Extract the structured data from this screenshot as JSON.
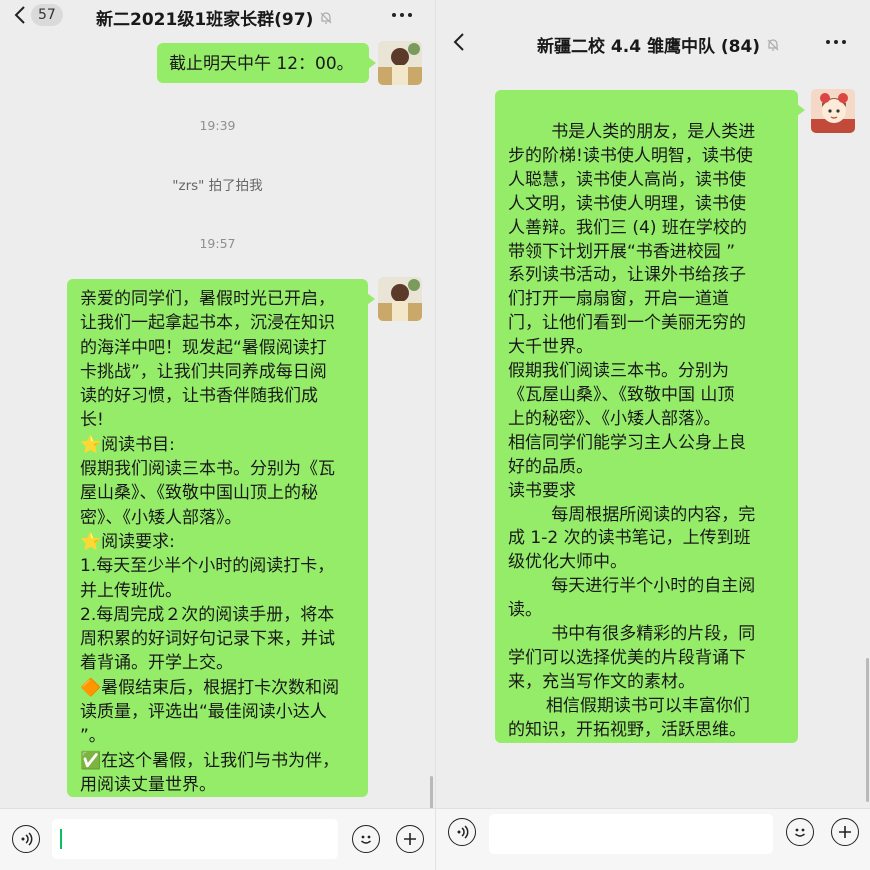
{
  "left": {
    "header": {
      "badge": "57",
      "title": "新二2021级1班家长群(97)"
    },
    "msg1": {
      "text": "截止明天中午 12：00。"
    },
    "time1": "19:39",
    "pat": "\"zrs\" 拍了拍我",
    "time2": "19:57",
    "msg2": {
      "lines": [
        "亲爱的同学们，暑假时光已开启，",
        "让我们一起拿起书本，沉浸在知识",
        "的海洋中吧！现发起“暑假阅读打",
        "卡挑战”，让我们共同养成每日阅",
        "读的好习惯，让书香伴随我们成",
        "长!",
        "⭐阅读书目:",
        "假期我们阅读三本书。分别为《瓦",
        "屋山桑》、《致敬中国山顶上的秘",
        "密》、《小矮人部落》。",
        "⭐阅读要求:",
        "1.每天至少半个小时的阅读打卡，",
        "并上传班优。",
        "2.每周完成２次的阅读手册，将本",
        "周积累的好词好句记录下来，并试",
        "着背诵。开学上交。",
        "🔶暑假结束后，根据打卡次数和阅",
        "读质量，评选出“最佳阅读小达人",
        "”。",
        "✅在这个暑假，让我们与书为伴，",
        "用阅读丈量世界。"
      ]
    },
    "icons": {
      "voice": "voice-icon",
      "emoji": "emoji-icon",
      "plus": "plus-icon",
      "back": "back-chevron-icon",
      "mute": "mute-bell-icon"
    }
  },
  "right": {
    "header": {
      "title": "新疆二校 4.4 雏鹰中队 (84)"
    },
    "msg": {
      "lines": [
        "        书是人类的朋友，是人类进",
        "步的阶梯!读书使人明智，读书使",
        "人聪慧，读书使人高尚，读书使",
        "人文明，读书使人明理，读书使",
        "人善辩。我们三 (4) 班在学校的",
        "带领下计划开展“书香进校园 ”",
        "系列读书活动，让课外书给孩子",
        "们打开一扇扇窗，开启一道道",
        "门，让他们看到一个美丽无穷的",
        "大千世界。",
        "假期我们阅读三本书。分别为",
        "《瓦屋山桑》、《致敬中国 山顶",
        "上的秘密》、《小矮人部落》。",
        "相信同学们能学习主人公身上良",
        "好的品质。",
        "读书要求",
        "        每周根据所阅读的内容，完",
        "成 1-2 次的读书笔记，上传到班",
        "级优化大师中。",
        "        每天进行半个小时的自主阅",
        "读。",
        "        书中有很多精彩的片段，同",
        "学们可以选择优美的片段背诵下",
        "来，充当写作文的素材。",
        "       相信假期读书可以丰富你们",
        "的知识，开拓视野，活跃思维。"
      ]
    }
  },
  "colors": {
    "bubble": "#95ec69",
    "background": "#ededed",
    "caret": "#07c160"
  }
}
